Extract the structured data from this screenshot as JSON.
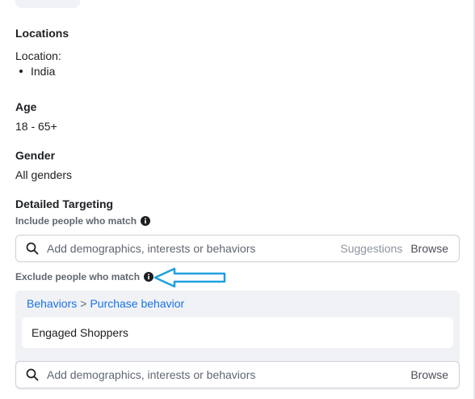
{
  "locations": {
    "heading": "Locations",
    "label": "Location:",
    "items": [
      "India"
    ]
  },
  "age": {
    "heading": "Age",
    "value": "18 - 65+"
  },
  "gender": {
    "heading": "Gender",
    "value": "All genders"
  },
  "detailed_targeting": {
    "heading": "Detailed Targeting",
    "include_label": "Include people who match",
    "include_search": {
      "placeholder": "Add demographics, interests or behaviors",
      "suggestions_label": "Suggestions",
      "browse_label": "Browse"
    },
    "exclude_label": "Exclude people who match",
    "exclude_breadcrumb": {
      "parent": "Behaviors",
      "separator": ">",
      "child": "Purchase behavior"
    },
    "exclude_items": [
      "Engaged Shoppers"
    ],
    "exclude_search": {
      "placeholder": "Add demographics, interests or behaviors",
      "browse_label": "Browse"
    }
  },
  "annotation": {
    "color": "#1ea0e0"
  },
  "colors": {
    "link": "#1a73e8",
    "panel_bg": "#f0f2f5"
  }
}
